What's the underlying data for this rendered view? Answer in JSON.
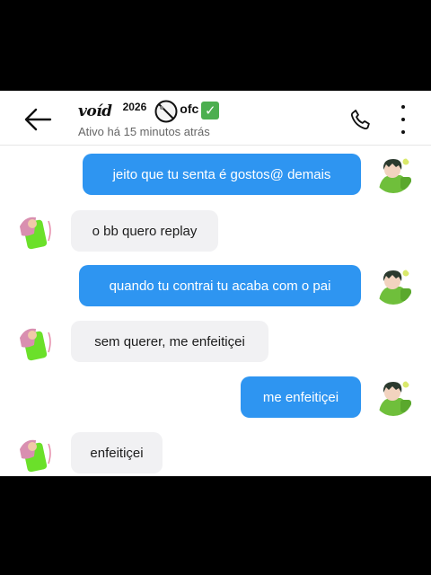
{
  "header": {
    "contact_name": "voíd",
    "contact_year": "2026",
    "contact_suffix": "ofc",
    "verified_mark": "✓",
    "status": "Ativo há 15 minutos atrás"
  },
  "icons": {
    "back": "arrow-left-icon",
    "call": "phone-icon",
    "more": "more-vertical-icon",
    "name_symbol": "prohibited-icon",
    "name_badge": "check-mark-icon"
  },
  "colors": {
    "outgoing_bubble": "#2e95f1",
    "incoming_bubble": "#f1f1f3",
    "verified_badge": "#4caf50"
  },
  "messages": [
    {
      "direction": "outgoing",
      "text": "jeito que tu senta é gostos@ demais"
    },
    {
      "direction": "incoming",
      "text": "o bb quero replay"
    },
    {
      "direction": "outgoing",
      "text": "quando tu contrai tu acaba com o pai"
    },
    {
      "direction": "incoming",
      "text": "sem querer, me enfeitiçei"
    },
    {
      "direction": "outgoing",
      "text": "me enfeitiçei"
    },
    {
      "direction": "incoming",
      "text": "enfeitiçei"
    }
  ]
}
